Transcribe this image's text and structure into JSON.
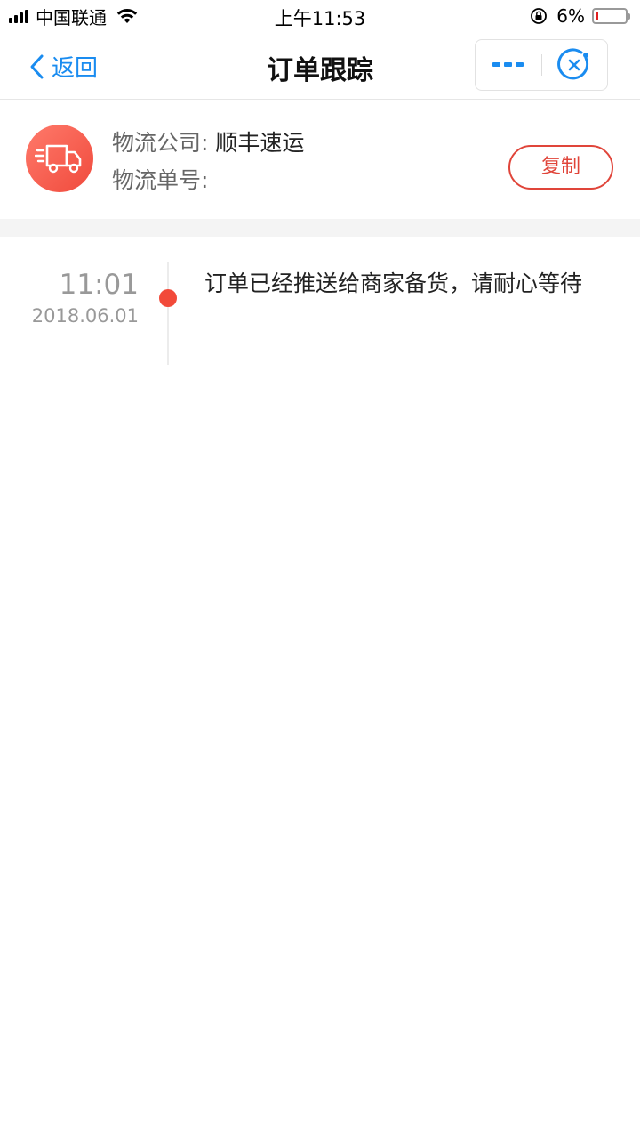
{
  "status_bar": {
    "carrier": "中国联通",
    "time": "上午11:53",
    "battery_percent": "6%",
    "battery_level": 0.06,
    "battery_color": "#e02020"
  },
  "nav": {
    "back_label": "返回",
    "title": "订单跟踪",
    "accent_color": "#1a8cf0",
    "icons": [
      "chevron-left-icon",
      "more-icon",
      "close-circle-icon"
    ]
  },
  "logistics": {
    "company_label": "物流公司:",
    "company_value": "顺丰速运",
    "tracking_label": "物流单号:",
    "tracking_value": "",
    "copy_label": "复制",
    "icon": "truck-icon",
    "accent_color": "#e0453a"
  },
  "timeline": {
    "entries": [
      {
        "time": "11:01",
        "date": "2018.06.01",
        "description": "订单已经推送给商家备货，请耐心等待"
      }
    ]
  }
}
